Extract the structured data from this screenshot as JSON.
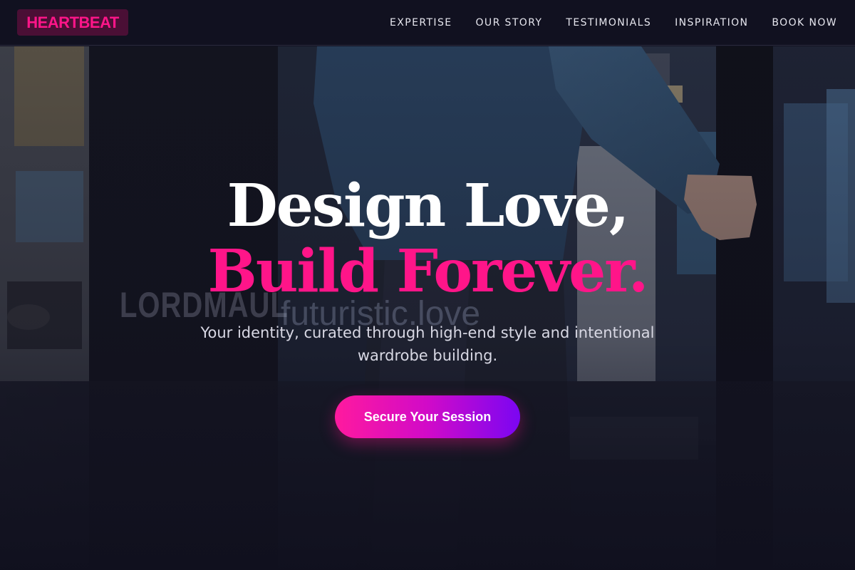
{
  "header": {
    "logo": "HEARTBEAT",
    "nav": [
      {
        "label": "EXPERTISE"
      },
      {
        "label": "OUR STORY"
      },
      {
        "label": "TESTIMONIALS"
      },
      {
        "label": "INSPIRATION"
      },
      {
        "label": "BOOK NOW"
      }
    ]
  },
  "hero": {
    "headline_line1": "Design Love,",
    "headline_line2": "Build Forever.",
    "subtext": "Your identity, curated through high-end style and intentional wardrobe building.",
    "cta_label": "Secure Your Session",
    "background_text": [
      "LORDMAUL",
      "futuristic.love"
    ]
  },
  "colors": {
    "accent": "#ff1589",
    "background": "#121222",
    "cta_gradient_start": "#ff1a9e",
    "cta_gradient_end": "#7b06f2"
  }
}
